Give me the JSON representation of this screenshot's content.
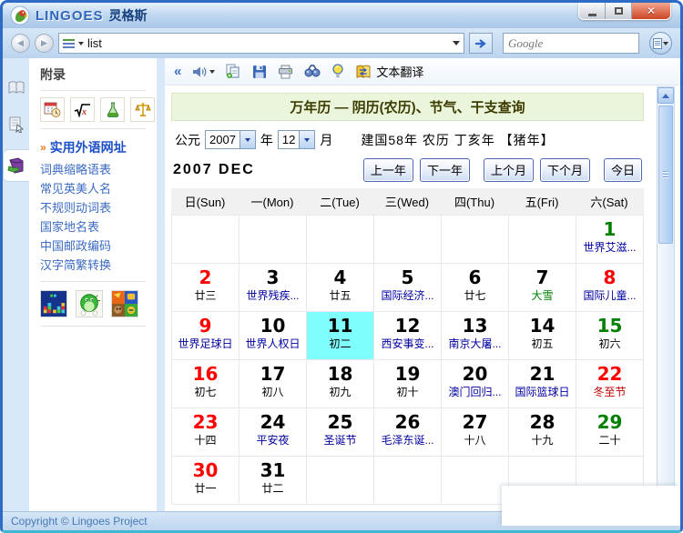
{
  "window": {
    "title_en": "LINGOES",
    "title_cn": "灵格斯"
  },
  "navbar": {
    "search_value": "list",
    "google_placeholder": "Google"
  },
  "sidebar": {
    "title": "附录",
    "featured_label": "实用外语网址",
    "featured_arrow": "»",
    "links": [
      "词典缩略语表",
      "常见英美人名",
      "不规则动词表",
      "国家地名表",
      "中国邮政编码",
      "汉字简繁转换"
    ]
  },
  "content_toolbar": {
    "collapse": "«",
    "translate_label": "文本翻译"
  },
  "calendar": {
    "banner": "万年历 — 阴历(农历)、节气、干支查询",
    "era_label": "公元",
    "year_value": "2007",
    "year_suffix": "年",
    "month_value": "12",
    "month_suffix": "月",
    "era_info": "建国58年 农历 丁亥年 【猪年】",
    "month_title": "2007 DEC",
    "nav_buttons": [
      {
        "name": "prev-year-button",
        "label": "上一年",
        "gap": false
      },
      {
        "name": "next-year-button",
        "label": "下一年",
        "gap": false
      },
      {
        "name": "prev-month-button",
        "label": "上个月",
        "gap": true
      },
      {
        "name": "next-month-button",
        "label": "下个月",
        "gap": false
      },
      {
        "name": "today-button",
        "label": "今日",
        "gap": true
      }
    ],
    "weekdays": [
      "日(Sun)",
      "一(Mon)",
      "二(Tue)",
      "三(Wed)",
      "四(Thu)",
      "五(Fri)",
      "六(Sat)"
    ],
    "cells": [
      {},
      {},
      {},
      {},
      {},
      {},
      {
        "d": "1",
        "dc": "green",
        "l": "世界艾滋...",
        "lc": "blue"
      },
      {
        "d": "2",
        "dc": "red",
        "l": "廿三",
        "lc": "black"
      },
      {
        "d": "3",
        "dc": "black",
        "l": "世界残疾...",
        "lc": "blue"
      },
      {
        "d": "4",
        "dc": "black",
        "l": "廿五",
        "lc": "black"
      },
      {
        "d": "5",
        "dc": "black",
        "l": "国际经济...",
        "lc": "blue"
      },
      {
        "d": "6",
        "dc": "black",
        "l": "廿七",
        "lc": "black"
      },
      {
        "d": "7",
        "dc": "black",
        "l": "大雪",
        "lc": "green"
      },
      {
        "d": "8",
        "dc": "red",
        "l": "国际儿童...",
        "lc": "blue"
      },
      {
        "d": "9",
        "dc": "red",
        "l": "世界足球日",
        "lc": "blue"
      },
      {
        "d": "10",
        "dc": "black",
        "l": "世界人权日",
        "lc": "blue"
      },
      {
        "d": "11",
        "dc": "black",
        "l": "初二",
        "lc": "black",
        "hl": true
      },
      {
        "d": "12",
        "dc": "black",
        "l": "西安事变...",
        "lc": "blue"
      },
      {
        "d": "13",
        "dc": "black",
        "l": "南京大屠...",
        "lc": "blue"
      },
      {
        "d": "14",
        "dc": "black",
        "l": "初五",
        "lc": "black"
      },
      {
        "d": "15",
        "dc": "green",
        "l": "初六",
        "lc": "black"
      },
      {
        "d": "16",
        "dc": "red",
        "l": "初七",
        "lc": "black"
      },
      {
        "d": "17",
        "dc": "black",
        "l": "初八",
        "lc": "black"
      },
      {
        "d": "18",
        "dc": "black",
        "l": "初九",
        "lc": "black"
      },
      {
        "d": "19",
        "dc": "black",
        "l": "初十",
        "lc": "black"
      },
      {
        "d": "20",
        "dc": "black",
        "l": "澳门回归...",
        "lc": "blue"
      },
      {
        "d": "21",
        "dc": "black",
        "l": "国际篮球日",
        "lc": "blue"
      },
      {
        "d": "22",
        "dc": "red",
        "l": "冬至节",
        "lc": "red"
      },
      {
        "d": "23",
        "dc": "red",
        "l": "十四",
        "lc": "black"
      },
      {
        "d": "24",
        "dc": "black",
        "l": "平安夜",
        "lc": "blue"
      },
      {
        "d": "25",
        "dc": "black",
        "l": "圣诞节",
        "lc": "blue"
      },
      {
        "d": "26",
        "dc": "black",
        "l": "毛泽东诞...",
        "lc": "blue"
      },
      {
        "d": "27",
        "dc": "black",
        "l": "十八",
        "lc": "black"
      },
      {
        "d": "28",
        "dc": "black",
        "l": "十九",
        "lc": "black"
      },
      {
        "d": "29",
        "dc": "green",
        "l": "二十",
        "lc": "black"
      },
      {
        "d": "30",
        "dc": "red",
        "l": "廿一",
        "lc": "black"
      },
      {
        "d": "31",
        "dc": "black",
        "l": "廿二",
        "lc": "black"
      },
      {},
      {},
      {},
      {},
      {}
    ],
    "colors": {
      "red": "#FF0000",
      "green": "#008000",
      "black": "#000000",
      "festival_blue": "#0000A0",
      "highlight": "#80FFFF"
    }
  },
  "statusbar": {
    "copyright": "Copyright © Lingoes Project"
  },
  "icons": {
    "titlebar": [
      "lingoes-parrot-logo",
      "minimize-icon",
      "maximize-icon",
      "close-icon"
    ],
    "navbar": [
      "back-icon",
      "forward-icon",
      "search-type-list-icon",
      "dropdown-icon",
      "go-arrow-icon",
      "search-magnifier-icon",
      "main-menu-icon"
    ],
    "content_toolbar": [
      "collapse-icon",
      "speaker-icon",
      "copy-icon",
      "save-icon",
      "print-icon",
      "find-icon",
      "lamp-icon",
      "text-translate-icon"
    ],
    "sidebar_tools": [
      "calendar-tool-icon",
      "math-tool-icon",
      "chemistry-tool-icon",
      "scales-tool-icon"
    ],
    "sidebar_games": [
      "blocks-game-icon",
      "bubble-game-icon",
      "puzzle-game-icon"
    ],
    "tabstrip": [
      "dictionary-tab-icon",
      "notes-tab-icon",
      "appendix-tab-icon"
    ]
  }
}
